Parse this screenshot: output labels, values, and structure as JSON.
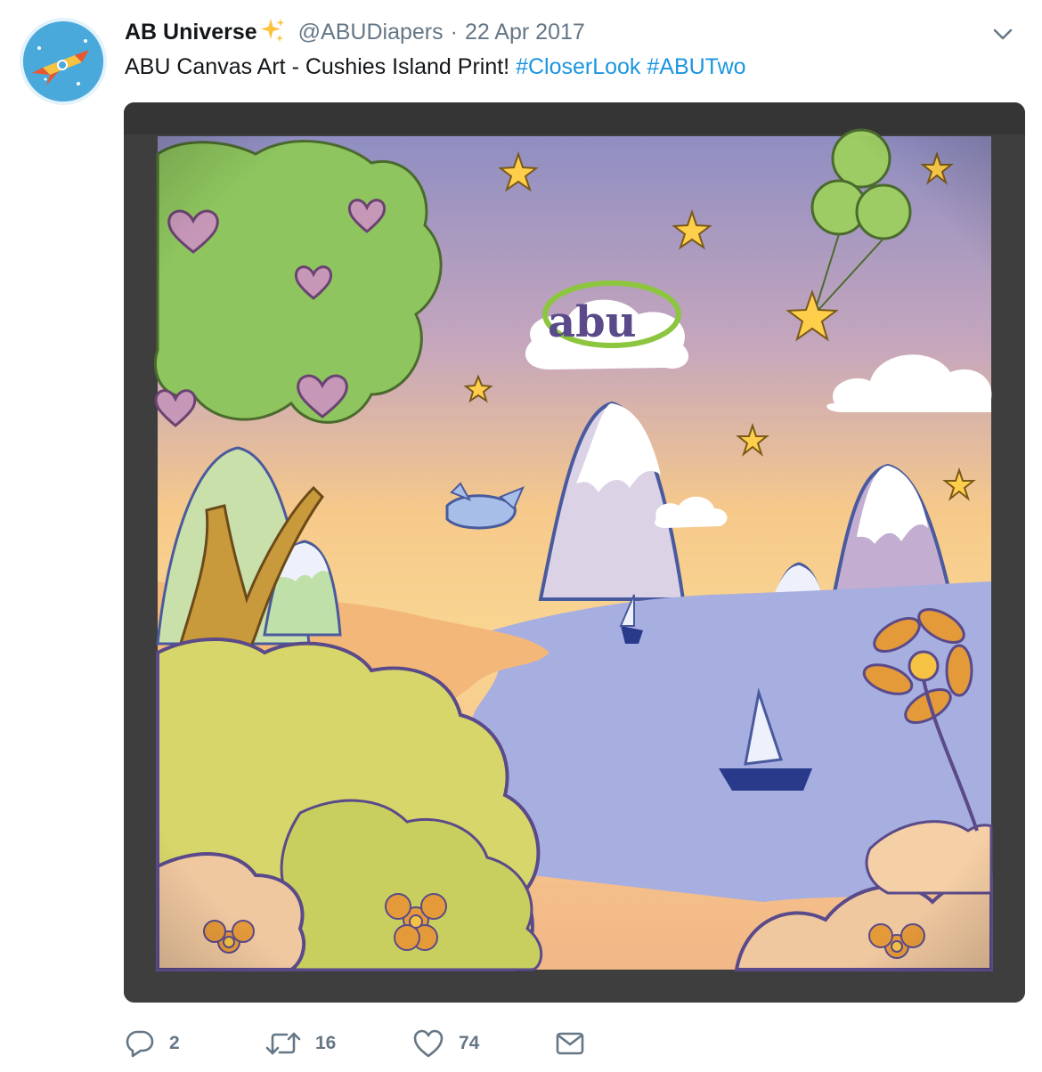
{
  "tweet": {
    "display_name": "AB Universe",
    "handle": "@ABUDiapers",
    "separator": "·",
    "date": "22 Apr 2017",
    "text_plain": "ABU Canvas Art - Cushies Island Print! ",
    "hashtags": [
      "#CloserLook",
      "#ABUTwo"
    ],
    "media_brand_text": "abu"
  },
  "actions": {
    "reply_count": "2",
    "retweet_count": "16",
    "like_count": "74"
  },
  "colors": {
    "hashtag": "#1b95e0",
    "muted": "#657786",
    "frame": "#3e3e3e"
  },
  "icons": {
    "avatar": "rocket-avatar",
    "sparkle": "sparkle-icon",
    "caret": "chevron-down-icon",
    "reply": "reply-icon",
    "retweet": "retweet-icon",
    "like": "heart-icon",
    "dm": "envelope-icon"
  }
}
